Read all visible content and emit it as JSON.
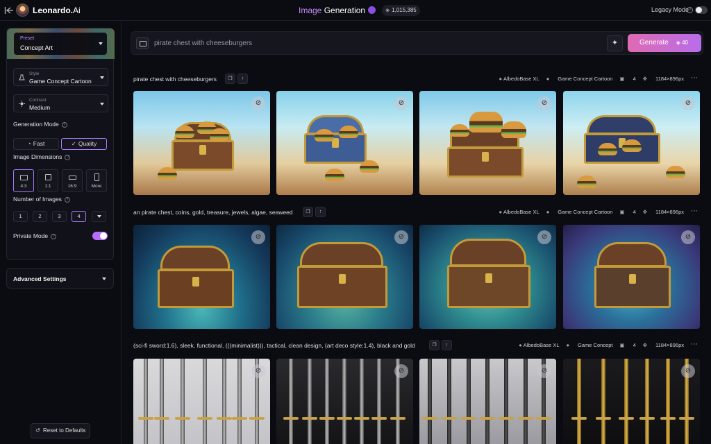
{
  "app": {
    "brand_name": "Leonardo.",
    "brand_suffix": "Ai",
    "title_part1": "Image",
    "title_part2": "Generation",
    "token_count": "1,015,385",
    "legacy_mode_label": "Legacy Mode"
  },
  "sidebar": {
    "preset_label": "Preset",
    "preset_value": "Concept Art",
    "style_label": "Style",
    "style_value": "Game Concept Cartoon",
    "contrast_label": "Contrast",
    "contrast_value": "Medium",
    "generation_mode_label": "Generation Mode",
    "mode_fast": "Fast",
    "mode_quality": "Quality",
    "image_dimensions_label": "Image Dimensions",
    "dims": [
      "4:3",
      "1:1",
      "16:9",
      "More"
    ],
    "number_of_images_label": "Number of Images",
    "nums": [
      "1",
      "2",
      "3",
      "4"
    ],
    "private_mode_label": "Private Mode",
    "advanced_settings_label": "Advanced Settings",
    "reset_label": "Reset to Defaults"
  },
  "prompt": {
    "placeholder": "pirate chest with cheeseburgers",
    "generate_label": "Generate",
    "generate_cost": "40"
  },
  "rows": [
    {
      "prompt": "pirate chest with cheeseburgers",
      "model": "AlbedoBase XL",
      "style": "Game Concept Cartoon",
      "count": "4",
      "size": "1184×896px"
    },
    {
      "prompt": "an pirate chest, coins, gold, treasure, jewels, algae, seaweed",
      "model": "AlbedoBase XL",
      "style": "Game Concept Cartoon",
      "count": "4",
      "size": "1184×896px"
    },
    {
      "prompt": "(sci-fi sword:1.6), sleek, functional, (((minimalist))), tactical, clean design, (art deco style:1.4), black and gold",
      "model": "AlbedoBase XL",
      "style": "Game Concept",
      "count": "4",
      "size": "1184×896px"
    }
  ],
  "colors": {
    "accent": "#b76bff",
    "generate_gradient_start": "#e06ab3",
    "generate_gradient_end": "#b86dea",
    "background": "#0b0c11"
  },
  "icons": [
    "back-arrow-icon",
    "image-upload-icon",
    "magic-wand-icon",
    "eye-off-icon",
    "copy-icon",
    "arrow-up-icon",
    "more-icon",
    "chevron-down-icon",
    "info-icon",
    "reset-icon",
    "token-icon"
  ]
}
